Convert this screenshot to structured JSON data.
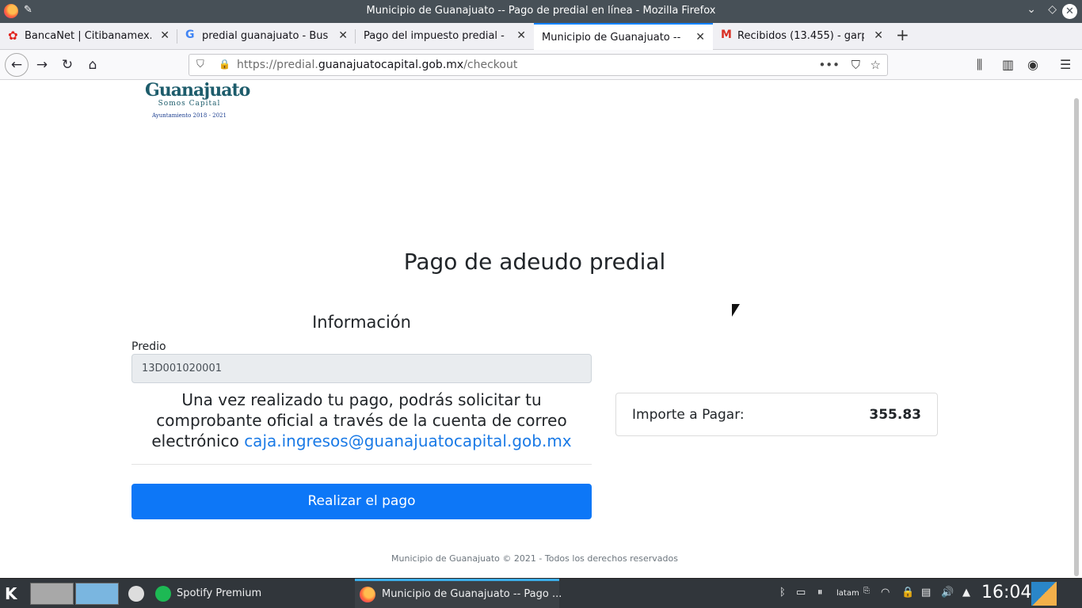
{
  "window": {
    "title": "Municipio de Guanajuato -- Pago de predial en línea - Mozilla Firefox"
  },
  "tabs": [
    {
      "label": "BancaNet | Citibanamex.c",
      "active": false
    },
    {
      "label": "predial guanajuato - Busca",
      "active": false
    },
    {
      "label": "Pago del impuesto predial - G",
      "active": false
    },
    {
      "label": "Municipio de Guanajuato -- Pa",
      "active": true
    },
    {
      "label": "Recibidos (13.455) - garpil",
      "active": false
    }
  ],
  "urlbar": {
    "prefix": "https://predial.",
    "domain": "guanajuatocapital.gob.mx",
    "path": "/checkout"
  },
  "logo": {
    "name": "Guanajuato",
    "tagline": "Somos Capital",
    "term": "Ayuntamiento 2018 - 2021"
  },
  "page": {
    "heading": "Pago de adeudo predial",
    "info_title": "Información",
    "predio_label": "Predio",
    "predio_value": "13D001020001",
    "note_text": "Una vez realizado tu pago, podrás solicitar tu comprobante oficial a través de la cuenta de correo electrónico ",
    "note_email": "caja.ingresos@guanajuatocapital.gob.mx",
    "pay_button": "Realizar el pago",
    "amount_label": "Importe a Pagar:",
    "amount_value": "355.83",
    "footer": "Municipio de Guanajuato © 2021 - Todos los derechos reservados"
  },
  "taskbar": {
    "apps": [
      {
        "label": "Spotify Premium"
      },
      {
        "label": "Municipio de Guanajuato -- Pago ..."
      }
    ],
    "keyboard_layout": "latam",
    "clock": "16:04"
  },
  "colors": {
    "accent": "#0d77f7",
    "link": "#1a7ae6",
    "titlebar": "#475057",
    "taskbar": "#31363b"
  }
}
